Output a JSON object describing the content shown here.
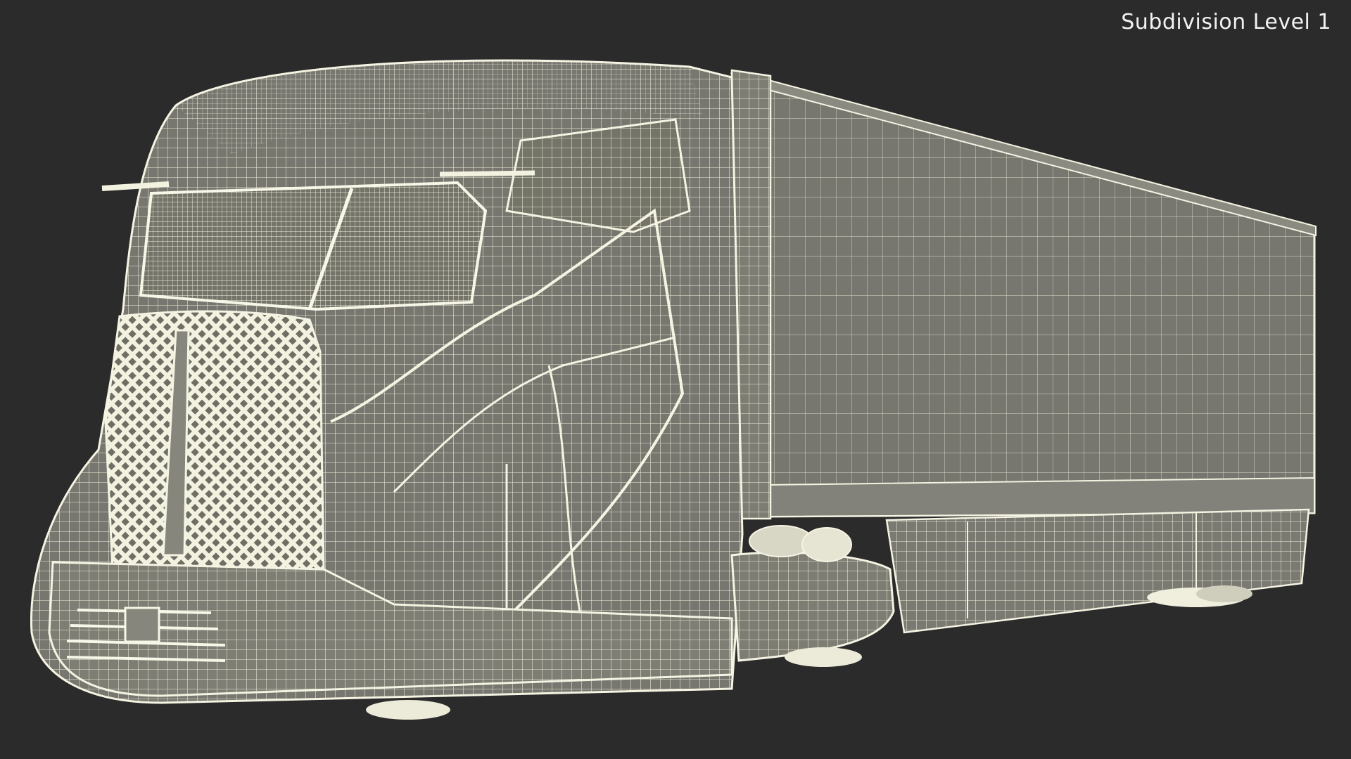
{
  "viewport": {
    "overlay_label": "Subdivision Level 1",
    "background_color": "#2b2b2b",
    "model_fill_color": "#7b7b70",
    "wire_color": "#f0eedd"
  }
}
